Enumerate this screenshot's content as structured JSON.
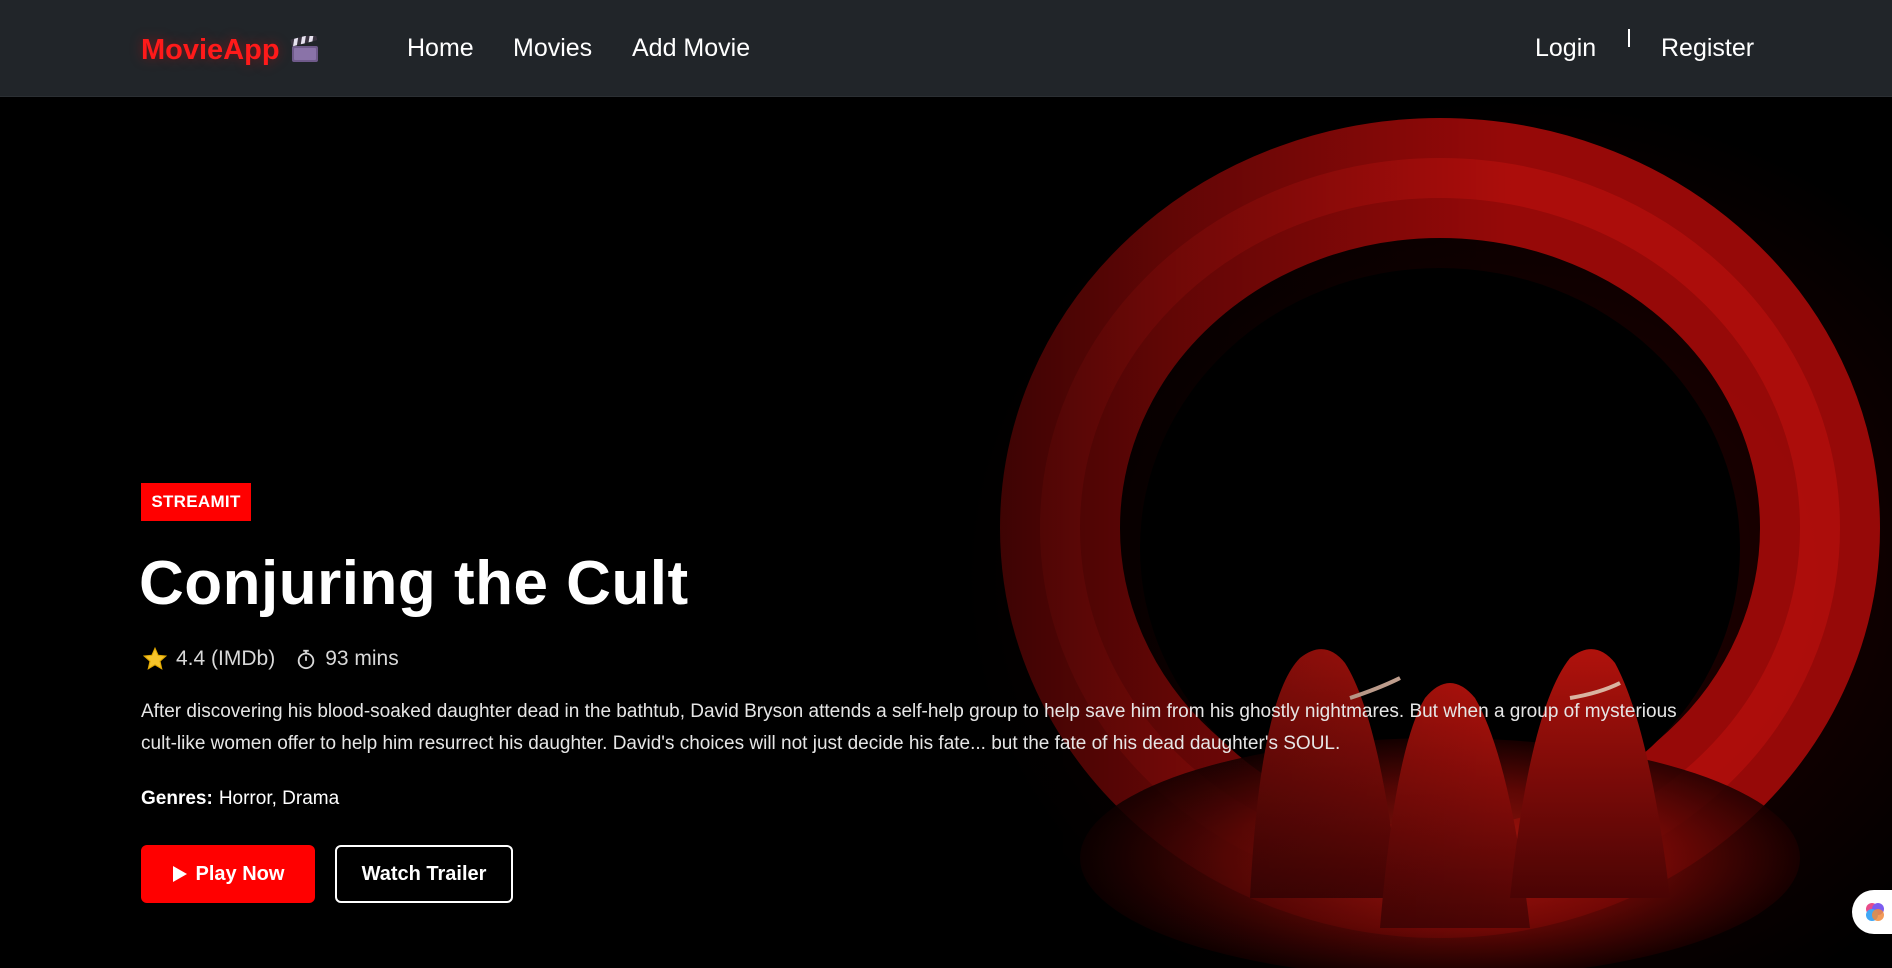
{
  "navbar": {
    "brand": "MovieApp",
    "brand_icon": "clapperboard-icon",
    "links": {
      "home": "Home",
      "movies": "Movies",
      "add_movie": "Add Movie"
    },
    "auth": {
      "login": "Login",
      "register": "Register"
    }
  },
  "hero": {
    "badge": "STREAMIT",
    "title": "Conjuring the Cult",
    "rating": "4.4 (IMDb)",
    "duration": "93 mins",
    "description": "After discovering his blood-soaked daughter dead in the bathtub, David Bryson attends a self-help group to help save him from his ghostly nightmares. But when a group of mysterious cult-like women offer to help him resurrect his daughter. David's choices will not just decide his fate... but the fate of his dead daughter's SOUL.",
    "genres_label": "Genres:",
    "genres": "Horror, Drama",
    "play_button": "Play Now",
    "trailer_button": "Watch Trailer"
  },
  "colors": {
    "accent": "#ff0000",
    "navbar_bg": "#212529",
    "background": "#000000"
  },
  "icons": {
    "rating": "star-icon",
    "duration": "stopwatch-icon",
    "play": "play-icon",
    "widget": "brain-icon"
  }
}
